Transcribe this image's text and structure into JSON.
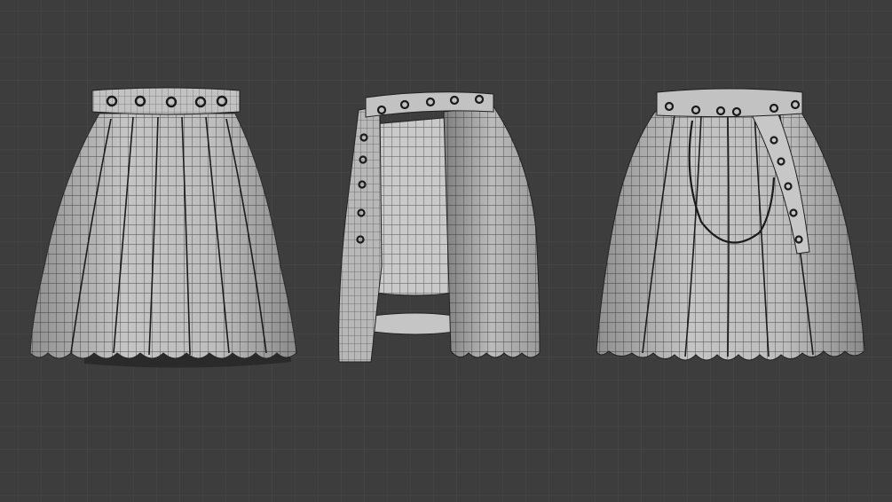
{
  "scene": {
    "background_color": "#3d3d3d",
    "grid_color": "#454545",
    "mesh_fill": "#b9b9b9",
    "wire_color": "#1f1f1f",
    "objects": [
      {
        "view": "front",
        "icon": "skirt-front-view"
      },
      {
        "view": "side",
        "icon": "skirt-side-view"
      },
      {
        "view": "back",
        "icon": "skirt-back-view"
      }
    ]
  }
}
